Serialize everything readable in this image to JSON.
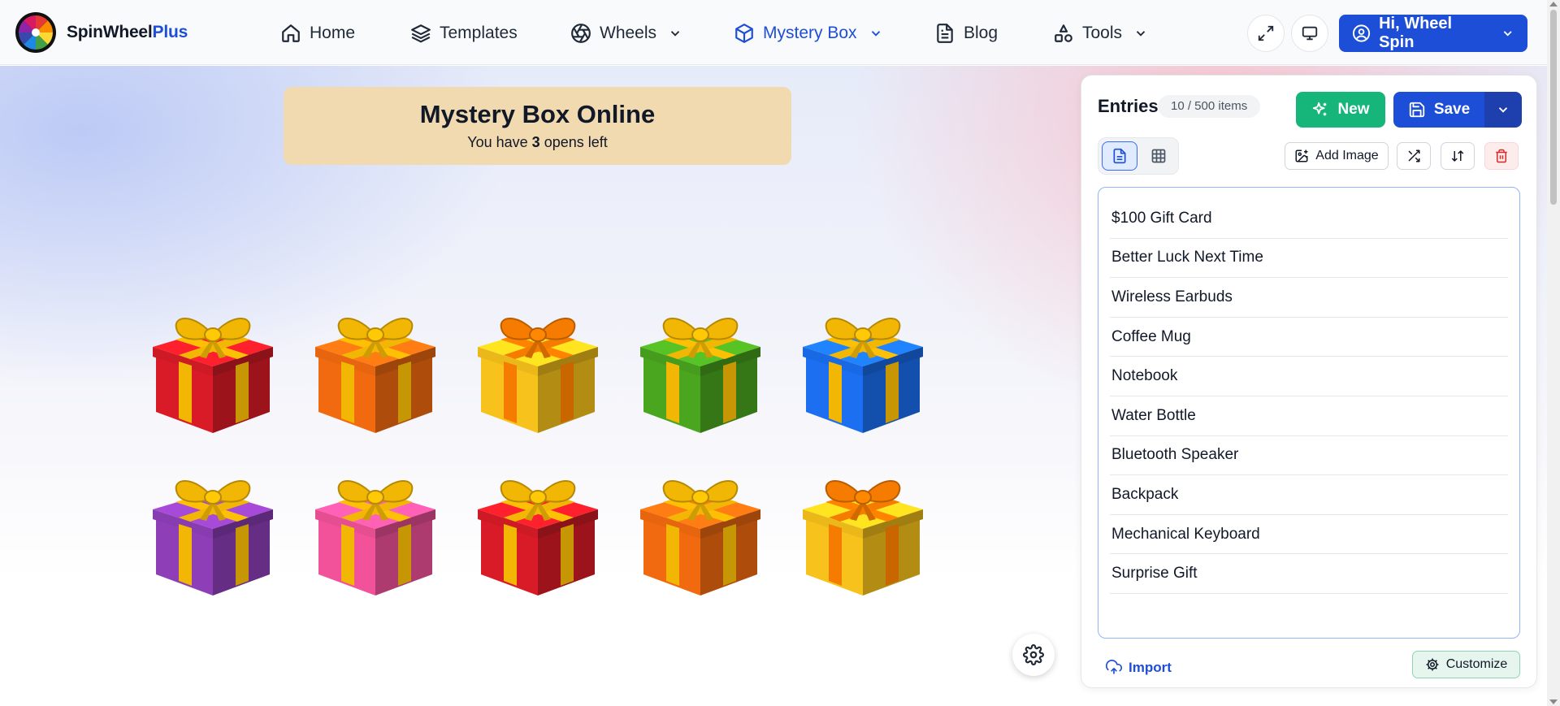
{
  "brand": {
    "name_main": "SpinWheel",
    "name_accent": "Plus",
    "accent_color": "#1d4ed8"
  },
  "nav": {
    "items": [
      {
        "label": "Home",
        "icon": "home-icon",
        "has_dropdown": false
      },
      {
        "label": "Templates",
        "icon": "layers-icon",
        "has_dropdown": false
      },
      {
        "label": "Wheels",
        "icon": "aperture-icon",
        "has_dropdown": true
      },
      {
        "label": "Mystery Box",
        "icon": "box-icon",
        "has_dropdown": true,
        "active": true
      },
      {
        "label": "Blog",
        "icon": "document-icon",
        "has_dropdown": false
      },
      {
        "label": "Tools",
        "icon": "shapes-icon",
        "has_dropdown": true
      }
    ],
    "user_label": "Hi, Wheel Spin"
  },
  "hero": {
    "title": "Mystery Box Online",
    "opens_prefix": "You have",
    "opens_count": "3",
    "opens_suffix": "opens left"
  },
  "gifts": [
    {
      "box": "#d81b26",
      "ribbon": "#f2b705"
    },
    {
      "box": "#f26a0f",
      "ribbon": "#f2b705"
    },
    {
      "box": "#f7c21b",
      "ribbon": "#f57c00"
    },
    {
      "box": "#4aa51f",
      "ribbon": "#f2b705"
    },
    {
      "box": "#1b6ff0",
      "ribbon": "#f2b705"
    },
    {
      "box": "#8e3fb8",
      "ribbon": "#f2b705"
    },
    {
      "box": "#f2529a",
      "ribbon": "#f2b705"
    },
    {
      "box": "#d81b26",
      "ribbon": "#f2b705"
    },
    {
      "box": "#f26a0f",
      "ribbon": "#f2b705"
    },
    {
      "box": "#f7c21b",
      "ribbon": "#f57c00"
    }
  ],
  "panel": {
    "title": "Entries",
    "count": "10 / 500 items",
    "new_label": "New",
    "save_label": "Save",
    "add_image_label": "Add Image",
    "import_label": "Import",
    "customize_label": "Customize",
    "entries": [
      "$100 Gift Card",
      "Better Luck Next Time",
      "Wireless Earbuds",
      "Coffee Mug",
      "Notebook",
      "Water Bottle",
      "Bluetooth Speaker",
      "Backpack",
      "Mechanical Keyboard",
      "Surprise Gift"
    ]
  }
}
